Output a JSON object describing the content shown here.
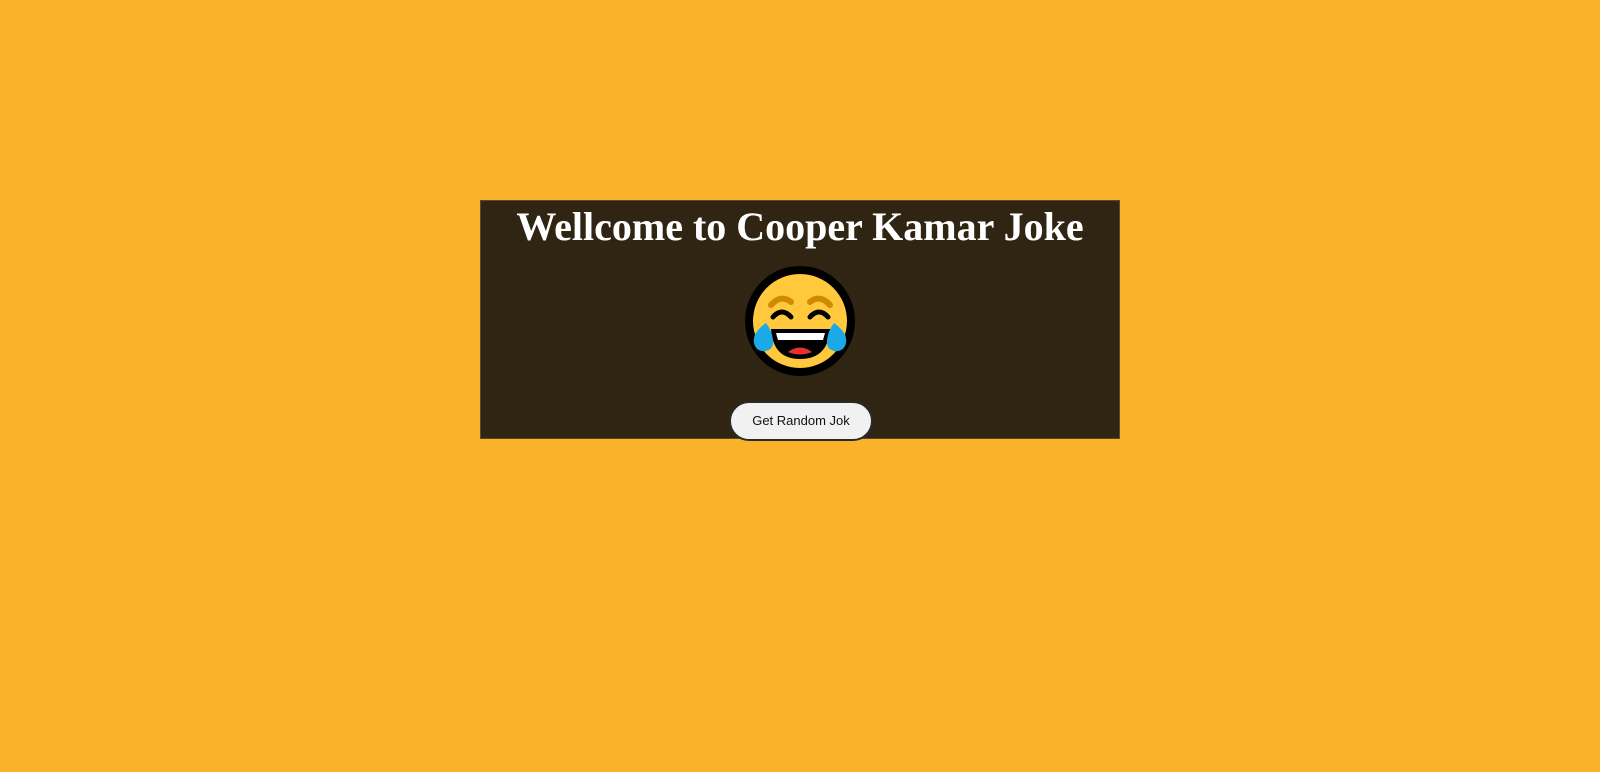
{
  "page": {
    "background_color": "#FAB22B"
  },
  "card": {
    "title": "Wellcome to Cooper Kamar Joke",
    "background_color": "#302512",
    "emoji_icon": "face-with-tears-of-joy-icon"
  },
  "actions": {
    "get_joke_label": "Get Random Jok"
  }
}
